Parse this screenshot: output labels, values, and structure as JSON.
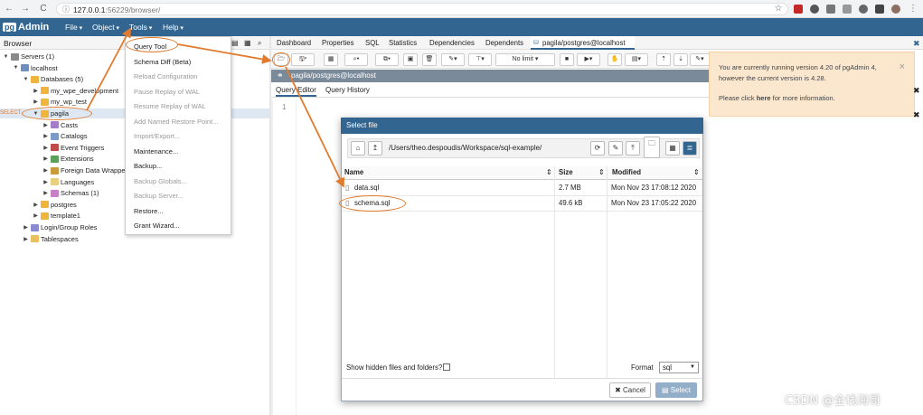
{
  "browser": {
    "url_host": "127.0.0.1",
    "url_rest": ":56229/browser/"
  },
  "app": {
    "logo_pg": "pg",
    "logo_admin": "Admin",
    "menus": [
      "File",
      "Object",
      "Tools",
      "Help"
    ]
  },
  "left_panel": {
    "title": "Browser",
    "select_tag": "SELECT",
    "tree": [
      {
        "label": "Servers (1)",
        "level": 0,
        "expanded": true
      },
      {
        "label": "localhost",
        "level": 1,
        "expanded": true
      },
      {
        "label": "Databases (5)",
        "level": 2,
        "expanded": true
      },
      {
        "label": "my_wpe_development",
        "level": 3,
        "expanded": false
      },
      {
        "label": "my_wp_test",
        "level": 3,
        "expanded": false
      },
      {
        "label": "pagila",
        "level": 3,
        "expanded": true
      },
      {
        "label": "Casts",
        "level": 4,
        "expanded": false
      },
      {
        "label": "Catalogs",
        "level": 4,
        "expanded": false
      },
      {
        "label": "Event Triggers",
        "level": 4,
        "expanded": false
      },
      {
        "label": "Extensions",
        "level": 4,
        "expanded": false
      },
      {
        "label": "Foreign Data Wrapper",
        "level": 4,
        "expanded": false
      },
      {
        "label": "Languages",
        "level": 4,
        "expanded": false
      },
      {
        "label": "Schemas (1)",
        "level": 4,
        "expanded": false
      },
      {
        "label": "postgres",
        "level": 3,
        "expanded": false
      },
      {
        "label": "template1",
        "level": 3,
        "expanded": false
      },
      {
        "label": "Login/Group Roles",
        "level": 2,
        "expanded": false
      },
      {
        "label": "Tablespaces",
        "level": 2,
        "expanded": false
      }
    ]
  },
  "tools_menu": {
    "items": [
      {
        "label": "Query Tool",
        "disabled": false
      },
      {
        "label": "Schema Diff (Beta)",
        "disabled": false
      },
      {
        "label": "Reload Configuration",
        "disabled": true
      },
      {
        "label": "Pause Replay of WAL",
        "disabled": true
      },
      {
        "label": "Resume Replay of WAL",
        "disabled": true
      },
      {
        "label": "Add Named Restore Point...",
        "disabled": true
      },
      {
        "label": "Import/Export...",
        "disabled": true
      },
      {
        "label": "Maintenance...",
        "disabled": false
      },
      {
        "label": "Backup...",
        "disabled": false
      },
      {
        "label": "Backup Globals...",
        "disabled": true
      },
      {
        "label": "Backup Server...",
        "disabled": true
      },
      {
        "label": "Restore...",
        "disabled": false
      },
      {
        "label": "Grant Wizard...",
        "disabled": false
      }
    ]
  },
  "tabs": [
    "Dashboard",
    "Properties",
    "SQL",
    "Statistics",
    "Dependencies",
    "Dependents"
  ],
  "active_tab": "pagila/postgres@localhost",
  "toolbar": {
    "limit_label": "No limit"
  },
  "connection": "pagila/postgres@localhost",
  "query_tabs": [
    "Query Editor",
    "Query History"
  ],
  "editor_line": "1",
  "notice": {
    "line1": "You are currently running version 4.20 of pgAdmin 4,",
    "line2": "however the current version is 4.28.",
    "line3_pre": "Please click ",
    "line3_link": "here",
    "line3_post": " for more information.",
    "close": "×"
  },
  "dialog": {
    "title": "Select file",
    "path": "/Users/theo.despoudis/Workspace/sql-example/",
    "columns": [
      "Name",
      "Size",
      "Modified"
    ],
    "files": [
      {
        "name": "data.sql",
        "size": "2.7 MB",
        "modified": "Mon Nov 23 17:08:12 2020"
      },
      {
        "name": "schema.sql",
        "size": "49.6 kB",
        "modified": "Mon Nov 23 17:05:22 2020"
      }
    ],
    "hidden_label": "Show hidden files and folders?",
    "format_label": "Format",
    "format_value": "sql",
    "cancel_label": "Cancel",
    "select_label": "Select"
  },
  "watermark": "CSDN @全栈海哥",
  "colors": {
    "brand": "#326690",
    "annotation": "#e07a2c",
    "notice_bg": "#fbe7ce"
  }
}
